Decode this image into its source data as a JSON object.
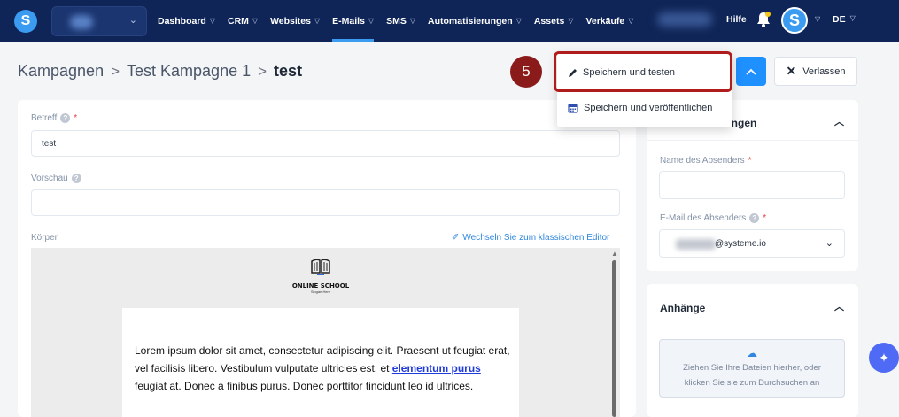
{
  "nav": {
    "logo_letter": "S",
    "items": [
      {
        "label": "Dashboard"
      },
      {
        "label": "CRM"
      },
      {
        "label": "Websites"
      },
      {
        "label": "E-Mails",
        "active": true
      },
      {
        "label": "SMS"
      },
      {
        "label": "Automatisierungen"
      },
      {
        "label": "Assets"
      },
      {
        "label": "Verkäufe"
      }
    ],
    "help_label": "Hilfe",
    "avatar_letter": "S",
    "language": "DE"
  },
  "breadcrumb": {
    "items": [
      "Kampagnen",
      "Test Kampagne 1"
    ],
    "current": "test",
    "separator": ">"
  },
  "header": {
    "step_number": "5",
    "leave_label": "Verlassen"
  },
  "dropdown": {
    "save_and_test": "Speichern und testen",
    "save_and_publish": "Speichern und veröffentlichen"
  },
  "form": {
    "subject_label": "Betreff",
    "subject_required": "*",
    "subject_value": "test",
    "preview_label": "Vorschau",
    "preview_value": "",
    "body_label": "Körper",
    "switch_editor_label": "Wechseln Sie zum klassischen Editor"
  },
  "email_content": {
    "logo_title": "ONLINE SCHOOL",
    "logo_slogan": "Slogan Here",
    "text_before_link": "Lorem ipsum dolor sit amet, consectetur adipiscing elit. Praesent ut feugiat erat, vel facilisis libero. Vestibulum vulputate ultricies est, et ",
    "link_text": "elementum purus",
    "text_after_link": " feugiat at. Donec a finibus purus. Donec porttitor tincidunt leo id ultrices."
  },
  "sender_settings": {
    "title_visible": "lungen",
    "sender_name_label": "Name des Absenders",
    "sender_name_required": "*",
    "sender_name_value": "",
    "sender_email_label": "E-Mail des Absenders",
    "sender_email_required": "*",
    "sender_email_domain": "@systeme.io"
  },
  "attachments": {
    "title": "Anhänge",
    "dropzone_line1": "Ziehen Sie Ihre Dateien hierher, oder",
    "dropzone_line2": "klicken Sie sie zum Durchsuchen an"
  },
  "colors": {
    "nav_bg": "#0f2557",
    "accent": "#1e90ff",
    "highlight_border": "#b01c1c",
    "step_badge": "#8b1a1a"
  }
}
